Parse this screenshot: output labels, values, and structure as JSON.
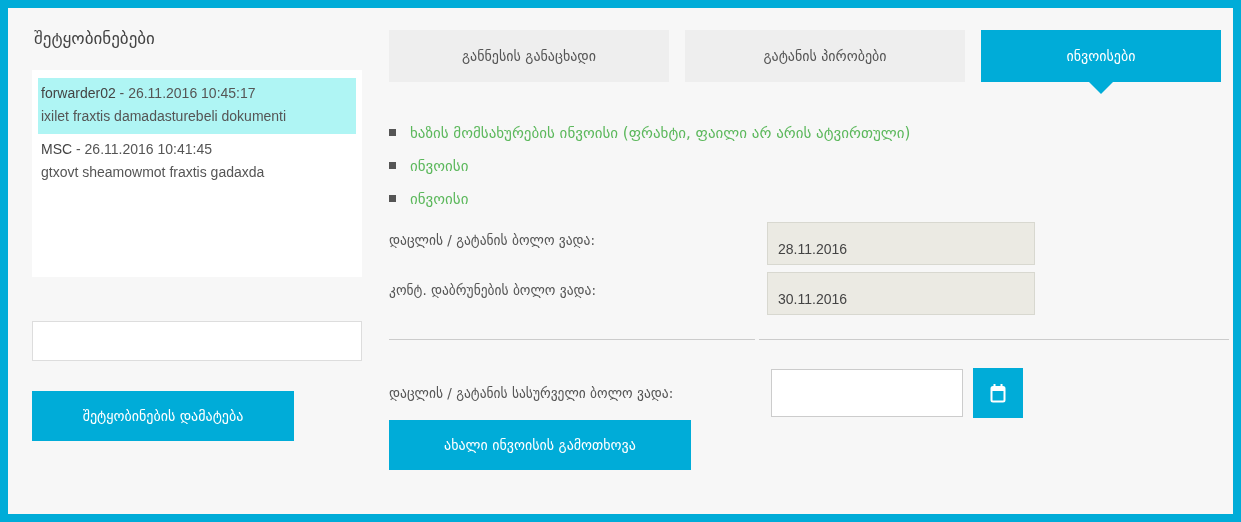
{
  "messages_panel": {
    "title": "შეტყობინებები",
    "messages": [
      {
        "sender": "forwarder02",
        "time": " - 26.11.2016 10:45:17",
        "text": "ixilet fraxtis damadasturebeli dokumenti",
        "selected": true
      },
      {
        "sender": "MSC",
        "time": " - 26.11.2016 10:41:45",
        "text": "gtxovt sheamowmot fraxtis gadaxda",
        "selected": false
      }
    ],
    "add_button": "შეტყობინების დამატება"
  },
  "tabs": [
    {
      "label": "განნესის განაცხადი",
      "selected": false
    },
    {
      "label": "გატანის პირობები",
      "selected": false
    },
    {
      "label": "ინვოისები",
      "selected": true
    }
  ],
  "invoices": [
    "ხაზის მომსახურების ინვოისი (ფრახტი, ფაილი არ არის ატვირთული)",
    "ინვოისი",
    "ინვოისი"
  ],
  "deadlines": [
    {
      "label": "დაცლის / გატანის ბოლო ვადა:",
      "value": "28.11.2016"
    },
    {
      "label": "კონტ. დაბრუნების ბოლო ვადა:",
      "value": "30.11.2016"
    }
  ],
  "request": {
    "label": "დაცლის / გატანის სასურველი ბოლო ვადა:",
    "button": "ახალი ინვოისის გამოთხოვა"
  }
}
